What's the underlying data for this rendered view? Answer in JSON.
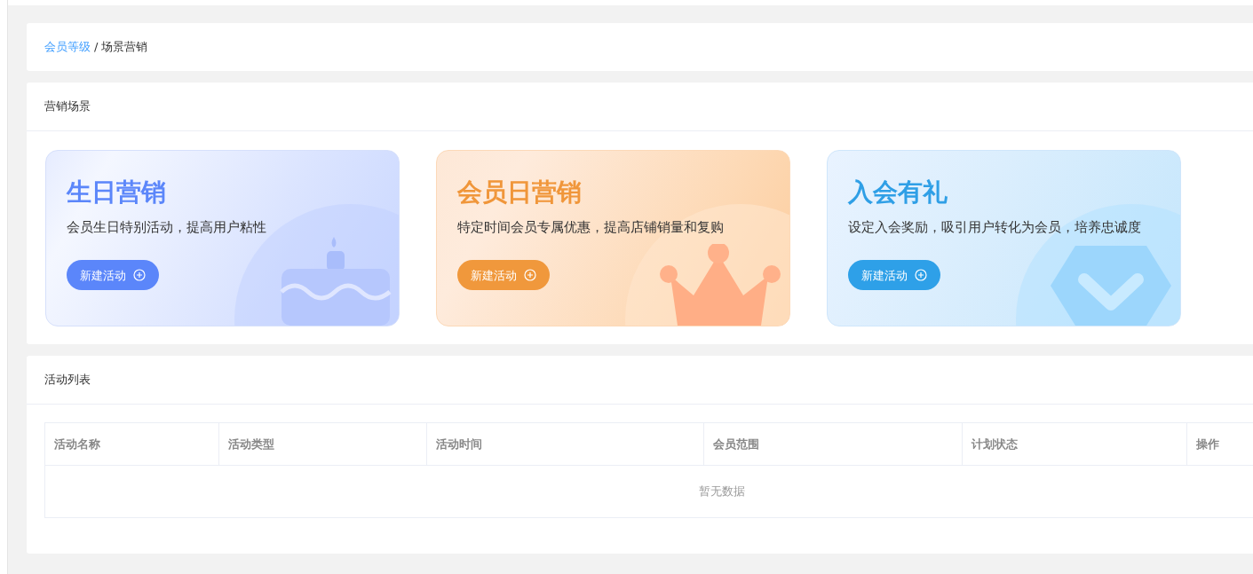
{
  "breadcrumb": [
    {
      "label": "会员等级",
      "link": true
    },
    {
      "label": "场景营销",
      "link": false
    }
  ],
  "breadcrumb_separator": "/",
  "scenes_panel": {
    "title": "营销场景",
    "cards": [
      {
        "kind": "birthday",
        "title": "生日营销",
        "description": "会员生日特别活动，提高用户粘性",
        "button": "新建活动"
      },
      {
        "kind": "member_day",
        "title": "会员日营销",
        "description": "特定时间会员专属优惠，提高店铺销量和复购",
        "button": "新建活动"
      },
      {
        "kind": "join_gift",
        "title": "入会有礼",
        "description": "设定入会奖励，吸引用户转化为会员，培养忠诚度",
        "button": "新建活动"
      }
    ]
  },
  "activity_panel": {
    "title": "活动列表",
    "table": {
      "columns": [
        "活动名称",
        "活动类型",
        "活动时间",
        "会员范围",
        "计划状态",
        "操作"
      ],
      "empty_text": "暂无数据"
    }
  }
}
